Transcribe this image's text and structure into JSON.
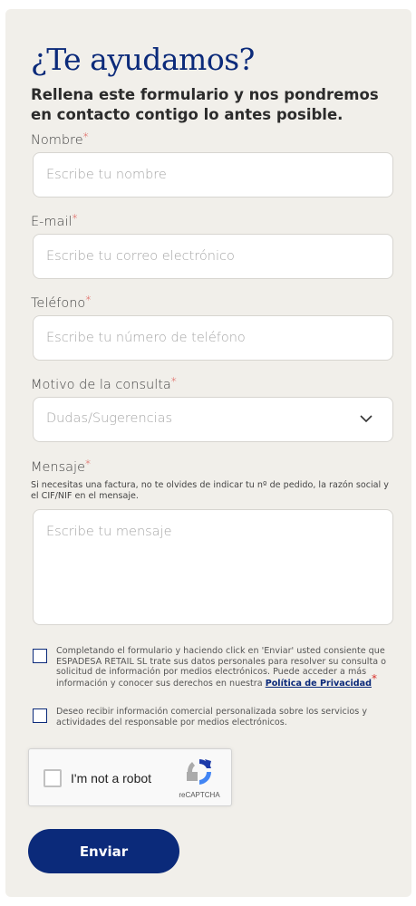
{
  "form": {
    "title": "¿Te ayudamos?",
    "subtitle": "Rellena este formulario y nos pondremos en contacto contigo lo antes posible.",
    "required_marker": "*",
    "fields": {
      "name": {
        "label": "Nombre",
        "placeholder": "Escribe tu nombre",
        "value": ""
      },
      "email": {
        "label": "E-mail",
        "placeholder": "Escribe tu correo electrónico",
        "value": ""
      },
      "phone": {
        "label": "Teléfono",
        "placeholder": "Escribe tu número de teléfono",
        "value": ""
      },
      "reason": {
        "label": "Motivo de la consulta",
        "selected": "Dudas/Sugerencias",
        "icon": "chevron-down-icon"
      },
      "message": {
        "label": "Mensaje",
        "hint": "Si necesitas una factura, no te olvides de indicar tu nº de pedido, la razón social y el CIF/NIF en el mensaje.",
        "placeholder": "Escribe tu mensaje",
        "value": ""
      }
    },
    "consents": {
      "privacy": {
        "text": "Completando el formulario y haciendo click en 'Enviar' usted consiente que ESPADESA RETAIL SL trate sus datos personales para resolver su consulta o solicitud de información por medios electrónicos. Puede acceder a más información y conocer sus derechos en nuestra ",
        "link": "Política de Privacidad",
        "checked": false
      },
      "marketing": {
        "text": "Deseo recibir información comercial personalizada sobre los servicios y actividades del responsable por medios electrónicos.",
        "checked": false
      }
    },
    "recaptcha": {
      "label": "I'm not a robot",
      "brand": "reCAPTCHA",
      "icon": "recaptcha-logo-icon"
    },
    "submit_label": "Enviar"
  },
  "colors": {
    "brand": "#0b2a7a",
    "required": "#d9312b",
    "card_bg": "#f1efea"
  }
}
